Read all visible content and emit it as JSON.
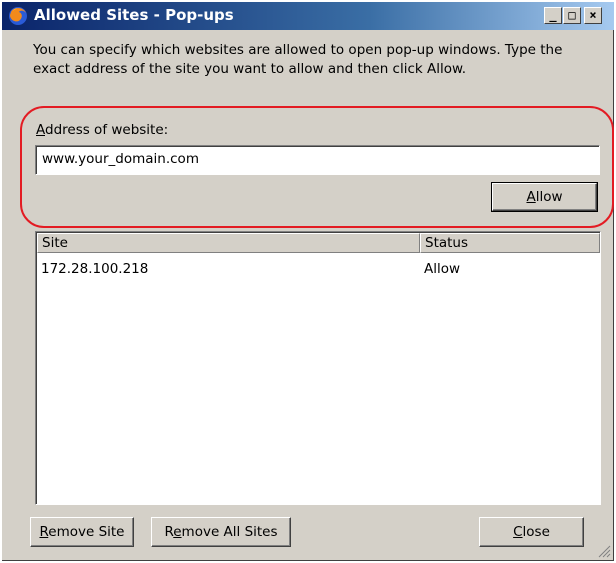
{
  "window": {
    "title": "Allowed Sites - Pop-ups",
    "icon": "firefox-icon",
    "controls": {
      "minimize": "_",
      "maximize": "□",
      "close": "×"
    }
  },
  "description": "You can specify which websites are allowed to open pop-up windows. Type the exact address of the site you want to allow and then click Allow.",
  "address": {
    "label": "Address of website:",
    "value": "www.your_domain.com"
  },
  "allow_button": {
    "label": "Allow"
  },
  "site_list": {
    "columns": [
      "Site",
      "Status"
    ],
    "rows": [
      {
        "site": "172.28.100.218",
        "status": "Allow"
      }
    ]
  },
  "buttons": {
    "remove_site": "Remove Site",
    "remove_all": "Remove All Sites",
    "close": "Close"
  },
  "colors": {
    "title_bar_start": "#0a246a",
    "title_bar_end": "#a6caf0",
    "dialog_bg": "#d4d0c8",
    "highlight_border": "#e31b23"
  }
}
